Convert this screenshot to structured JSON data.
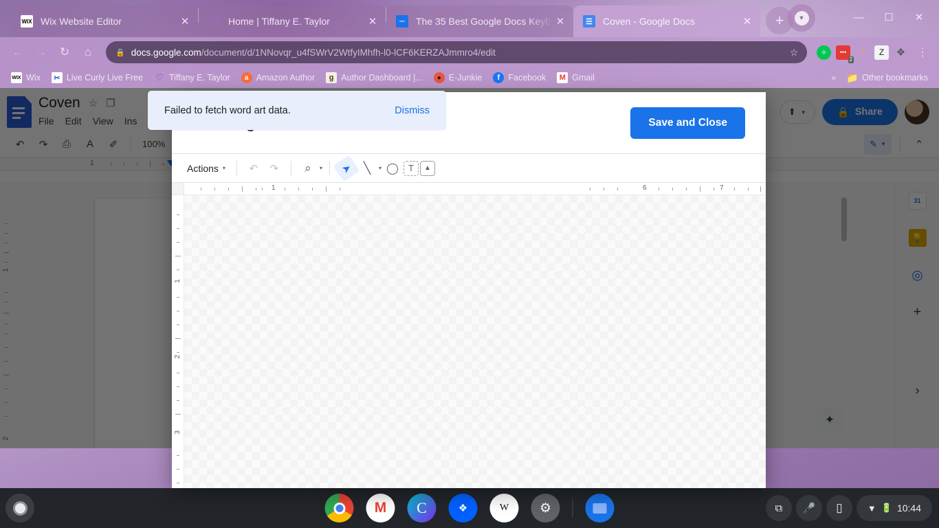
{
  "browser": {
    "tabs": [
      {
        "title": "Wix Website Editor",
        "favicon": "wix-icon",
        "active": false,
        "closable": true
      },
      {
        "title": "Home | Tiffany E. Taylor",
        "favicon": "heart-icon",
        "active": false,
        "closable": true
      },
      {
        "title": "The 35 Best Google Docs Keyb",
        "favicon": "article-icon",
        "active": false,
        "closable": true
      },
      {
        "title": "Coven - Google Docs",
        "favicon": "google-docs-icon",
        "active": true,
        "closable": true
      }
    ],
    "new_tab_label": "+",
    "window_controls": {
      "minimize": "—",
      "maximize": "☐",
      "close": "✕"
    },
    "nav": {
      "back": "←",
      "forward": "→",
      "reload": "↻",
      "home": "⌂"
    },
    "omnibox": {
      "lock_icon": "lock-icon",
      "host": "docs.google.com",
      "path": "/document/d/1NNovqr_u4fSWrV2WtfyIMhfh-l0-lCF6KERZAJmmro4/edit",
      "bookmark_star": "☆"
    },
    "extensions": [
      {
        "name": "shield-extension-icon",
        "glyph": "✿",
        "badge": ""
      },
      {
        "name": "chat-extension-icon",
        "glyph": "•••",
        "badge": "2"
      },
      {
        "name": "rss-extension-icon",
        "glyph": "◔",
        "badge": ""
      },
      {
        "name": "zotero-extension-icon",
        "glyph": "Z",
        "badge": ""
      },
      {
        "name": "puzzle-extensions-icon",
        "glyph": "❖",
        "badge": ""
      }
    ],
    "menu_icon": "⋮",
    "bookmarks": [
      {
        "label": "Wix",
        "icon": "wix-icon"
      },
      {
        "label": "Live Curly Live Free",
        "icon": "scissors-icon"
      },
      {
        "label": "Tiffany E. Taylor",
        "icon": "heart-icon"
      },
      {
        "label": "Amazon Author",
        "icon": "amazon-icon"
      },
      {
        "label": "Author Dashboard |...",
        "icon": "goodreads-icon"
      },
      {
        "label": "E-Junkie",
        "icon": "ejunkie-icon"
      },
      {
        "label": "Facebook",
        "icon": "facebook-icon"
      },
      {
        "label": "Gmail",
        "icon": "gmail-icon"
      }
    ],
    "bookmarks_overflow": "»",
    "other_bookmarks": {
      "label": "Other bookmarks",
      "icon": "folder-icon"
    }
  },
  "docs": {
    "title": "Coven",
    "star_icon": "☆",
    "move_icon": "❐",
    "menus": [
      "File",
      "Edit",
      "View",
      "Ins"
    ],
    "toolbar": {
      "undo": "↶",
      "redo": "↷",
      "print": "⎙",
      "spellcheck": "A",
      "paint_format": "✐",
      "zoom_level": "100%",
      "mode_label": "✎",
      "collapse": "⌃"
    },
    "share_button": {
      "label": "Share",
      "icon": "lock-icon"
    },
    "comment_icon": "⬆",
    "side_panel": [
      {
        "name": "google-calendar-icon",
        "glyph": "31"
      },
      {
        "name": "google-keep-icon",
        "glyph": "●"
      },
      {
        "name": "google-tasks-icon",
        "glyph": "◎"
      },
      {
        "name": "add-on-plus-icon",
        "glyph": "+"
      },
      {
        "name": "expand-panel-chevron-icon",
        "glyph": "›"
      }
    ],
    "explore_button": "✦",
    "ruler_numbers_h": [
      "1"
    ],
    "ruler_numbers_v": [
      "1",
      "2"
    ]
  },
  "drawing_dialog": {
    "title": "Drawing",
    "save_button": "Save and Close",
    "toolbar": {
      "actions_label": "Actions",
      "actions_caret": "▾",
      "undo": "↶",
      "redo": "↷",
      "zoom": "⌕",
      "zoom_caret": "▾",
      "select": "➤",
      "line": "╲",
      "line_caret": "▾",
      "shape": "◯",
      "textbox": "T",
      "image": "⛰"
    },
    "ruler_numbers_h": [
      "1",
      "6",
      "7"
    ],
    "ruler_numbers_v": [
      "1",
      "2",
      "3"
    ]
  },
  "toast": {
    "message": "Failed to fetch word art data.",
    "action": "Dismiss"
  },
  "shelf": {
    "launcher": "launcher-icon",
    "apps": [
      {
        "name": "chrome-app-icon",
        "glyph": ""
      },
      {
        "name": "gmail-app-icon",
        "glyph": "M"
      },
      {
        "name": "canva-app-icon",
        "glyph": "C"
      },
      {
        "name": "dropbox-app-icon",
        "glyph": "❖"
      },
      {
        "name": "wikipedia-app-icon",
        "glyph": "W"
      },
      {
        "name": "settings-app-icon",
        "glyph": "⚙"
      },
      {
        "name": "files-app-icon",
        "glyph": "▰"
      }
    ],
    "status": {
      "screen_capture": "⧉",
      "microphone": "ᴛ",
      "phone_hub": "▯",
      "wifi": "wifi-icon",
      "battery": "battery-icon",
      "time": "10:44"
    }
  },
  "colors": {
    "accent_blue": "#1a73e8",
    "toast_bg": "#e8eefb",
    "share_blue": "#1a73e8",
    "shelf_bg": "#22252a"
  }
}
